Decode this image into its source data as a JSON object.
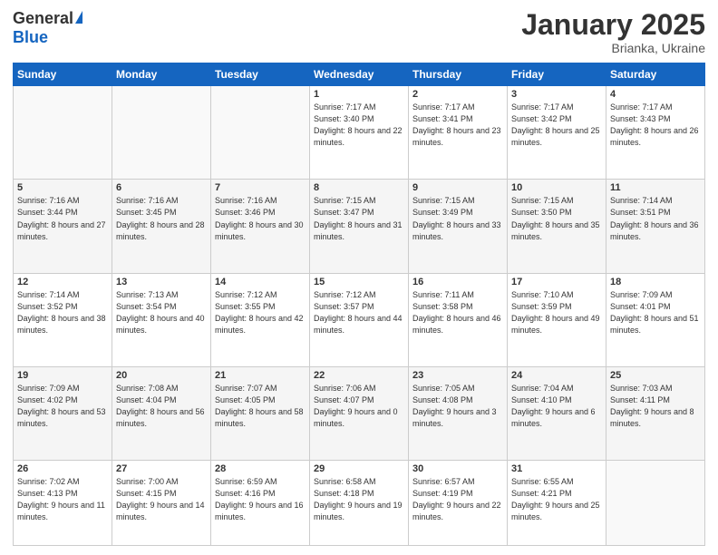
{
  "header": {
    "logo_general": "General",
    "logo_blue": "Blue",
    "month": "January 2025",
    "location": "Brianka, Ukraine"
  },
  "weekdays": [
    "Sunday",
    "Monday",
    "Tuesday",
    "Wednesday",
    "Thursday",
    "Friday",
    "Saturday"
  ],
  "weeks": [
    [
      {
        "day": "",
        "sunrise": "",
        "sunset": "",
        "daylight": ""
      },
      {
        "day": "",
        "sunrise": "",
        "sunset": "",
        "daylight": ""
      },
      {
        "day": "",
        "sunrise": "",
        "sunset": "",
        "daylight": ""
      },
      {
        "day": "1",
        "sunrise": "Sunrise: 7:17 AM",
        "sunset": "Sunset: 3:40 PM",
        "daylight": "Daylight: 8 hours and 22 minutes."
      },
      {
        "day": "2",
        "sunrise": "Sunrise: 7:17 AM",
        "sunset": "Sunset: 3:41 PM",
        "daylight": "Daylight: 8 hours and 23 minutes."
      },
      {
        "day": "3",
        "sunrise": "Sunrise: 7:17 AM",
        "sunset": "Sunset: 3:42 PM",
        "daylight": "Daylight: 8 hours and 25 minutes."
      },
      {
        "day": "4",
        "sunrise": "Sunrise: 7:17 AM",
        "sunset": "Sunset: 3:43 PM",
        "daylight": "Daylight: 8 hours and 26 minutes."
      }
    ],
    [
      {
        "day": "5",
        "sunrise": "Sunrise: 7:16 AM",
        "sunset": "Sunset: 3:44 PM",
        "daylight": "Daylight: 8 hours and 27 minutes."
      },
      {
        "day": "6",
        "sunrise": "Sunrise: 7:16 AM",
        "sunset": "Sunset: 3:45 PM",
        "daylight": "Daylight: 8 hours and 28 minutes."
      },
      {
        "day": "7",
        "sunrise": "Sunrise: 7:16 AM",
        "sunset": "Sunset: 3:46 PM",
        "daylight": "Daylight: 8 hours and 30 minutes."
      },
      {
        "day": "8",
        "sunrise": "Sunrise: 7:15 AM",
        "sunset": "Sunset: 3:47 PM",
        "daylight": "Daylight: 8 hours and 31 minutes."
      },
      {
        "day": "9",
        "sunrise": "Sunrise: 7:15 AM",
        "sunset": "Sunset: 3:49 PM",
        "daylight": "Daylight: 8 hours and 33 minutes."
      },
      {
        "day": "10",
        "sunrise": "Sunrise: 7:15 AM",
        "sunset": "Sunset: 3:50 PM",
        "daylight": "Daylight: 8 hours and 35 minutes."
      },
      {
        "day": "11",
        "sunrise": "Sunrise: 7:14 AM",
        "sunset": "Sunset: 3:51 PM",
        "daylight": "Daylight: 8 hours and 36 minutes."
      }
    ],
    [
      {
        "day": "12",
        "sunrise": "Sunrise: 7:14 AM",
        "sunset": "Sunset: 3:52 PM",
        "daylight": "Daylight: 8 hours and 38 minutes."
      },
      {
        "day": "13",
        "sunrise": "Sunrise: 7:13 AM",
        "sunset": "Sunset: 3:54 PM",
        "daylight": "Daylight: 8 hours and 40 minutes."
      },
      {
        "day": "14",
        "sunrise": "Sunrise: 7:12 AM",
        "sunset": "Sunset: 3:55 PM",
        "daylight": "Daylight: 8 hours and 42 minutes."
      },
      {
        "day": "15",
        "sunrise": "Sunrise: 7:12 AM",
        "sunset": "Sunset: 3:57 PM",
        "daylight": "Daylight: 8 hours and 44 minutes."
      },
      {
        "day": "16",
        "sunrise": "Sunrise: 7:11 AM",
        "sunset": "Sunset: 3:58 PM",
        "daylight": "Daylight: 8 hours and 46 minutes."
      },
      {
        "day": "17",
        "sunrise": "Sunrise: 7:10 AM",
        "sunset": "Sunset: 3:59 PM",
        "daylight": "Daylight: 8 hours and 49 minutes."
      },
      {
        "day": "18",
        "sunrise": "Sunrise: 7:09 AM",
        "sunset": "Sunset: 4:01 PM",
        "daylight": "Daylight: 8 hours and 51 minutes."
      }
    ],
    [
      {
        "day": "19",
        "sunrise": "Sunrise: 7:09 AM",
        "sunset": "Sunset: 4:02 PM",
        "daylight": "Daylight: 8 hours and 53 minutes."
      },
      {
        "day": "20",
        "sunrise": "Sunrise: 7:08 AM",
        "sunset": "Sunset: 4:04 PM",
        "daylight": "Daylight: 8 hours and 56 minutes."
      },
      {
        "day": "21",
        "sunrise": "Sunrise: 7:07 AM",
        "sunset": "Sunset: 4:05 PM",
        "daylight": "Daylight: 8 hours and 58 minutes."
      },
      {
        "day": "22",
        "sunrise": "Sunrise: 7:06 AM",
        "sunset": "Sunset: 4:07 PM",
        "daylight": "Daylight: 9 hours and 0 minutes."
      },
      {
        "day": "23",
        "sunrise": "Sunrise: 7:05 AM",
        "sunset": "Sunset: 4:08 PM",
        "daylight": "Daylight: 9 hours and 3 minutes."
      },
      {
        "day": "24",
        "sunrise": "Sunrise: 7:04 AM",
        "sunset": "Sunset: 4:10 PM",
        "daylight": "Daylight: 9 hours and 6 minutes."
      },
      {
        "day": "25",
        "sunrise": "Sunrise: 7:03 AM",
        "sunset": "Sunset: 4:11 PM",
        "daylight": "Daylight: 9 hours and 8 minutes."
      }
    ],
    [
      {
        "day": "26",
        "sunrise": "Sunrise: 7:02 AM",
        "sunset": "Sunset: 4:13 PM",
        "daylight": "Daylight: 9 hours and 11 minutes."
      },
      {
        "day": "27",
        "sunrise": "Sunrise: 7:00 AM",
        "sunset": "Sunset: 4:15 PM",
        "daylight": "Daylight: 9 hours and 14 minutes."
      },
      {
        "day": "28",
        "sunrise": "Sunrise: 6:59 AM",
        "sunset": "Sunset: 4:16 PM",
        "daylight": "Daylight: 9 hours and 16 minutes."
      },
      {
        "day": "29",
        "sunrise": "Sunrise: 6:58 AM",
        "sunset": "Sunset: 4:18 PM",
        "daylight": "Daylight: 9 hours and 19 minutes."
      },
      {
        "day": "30",
        "sunrise": "Sunrise: 6:57 AM",
        "sunset": "Sunset: 4:19 PM",
        "daylight": "Daylight: 9 hours and 22 minutes."
      },
      {
        "day": "31",
        "sunrise": "Sunrise: 6:55 AM",
        "sunset": "Sunset: 4:21 PM",
        "daylight": "Daylight: 9 hours and 25 minutes."
      },
      {
        "day": "",
        "sunrise": "",
        "sunset": "",
        "daylight": ""
      }
    ]
  ]
}
